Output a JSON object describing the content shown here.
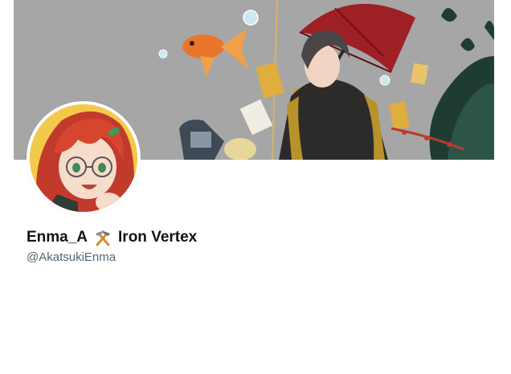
{
  "profile": {
    "name_prefix": "Enma_A",
    "name_suffix": "Iron Vertex",
    "name_emoji_icon": "hammer-and-pick-icon",
    "handle": "@AkatsukiEnma"
  },
  "colors": {
    "banner_bg": "#a6a6a6",
    "name_text": "#0f1419",
    "handle_text": "#536471",
    "avatar_bg": "#f2c94a",
    "umbrella_red": "#9e1f24"
  }
}
